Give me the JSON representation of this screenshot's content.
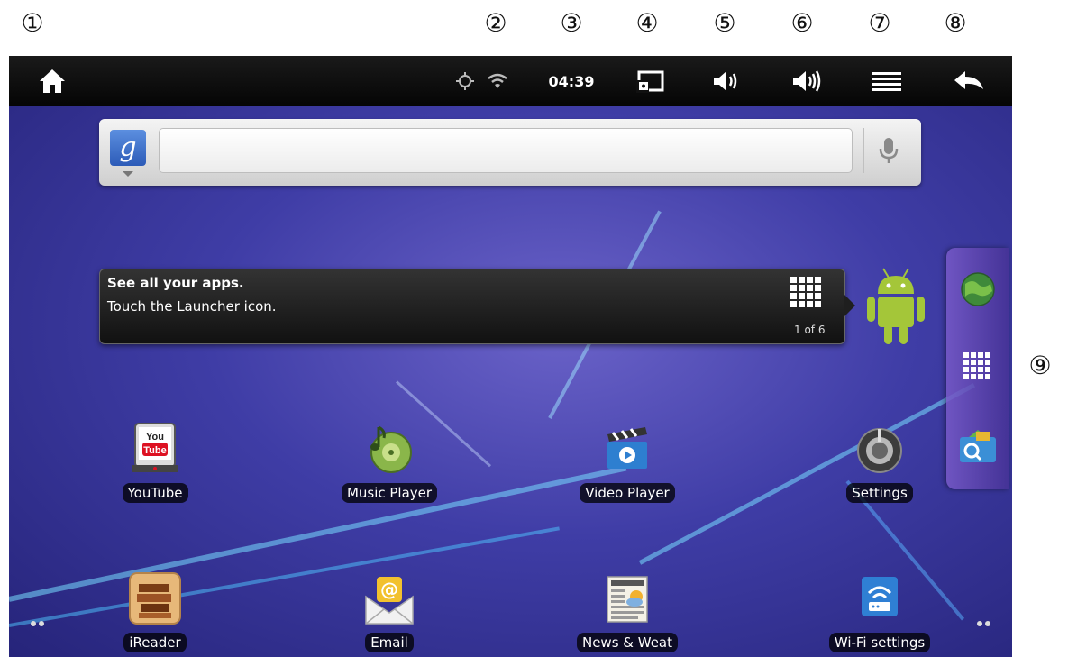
{
  "callouts": [
    "①",
    "②",
    "③",
    "④",
    "⑤",
    "⑥",
    "⑦",
    "⑧",
    "⑨"
  ],
  "status_bar": {
    "time": "04:39",
    "icons": [
      "home-icon",
      "gps-icon",
      "wifi-icon",
      "screenshot-icon",
      "volume-down-icon",
      "volume-up-icon",
      "menu-icon",
      "back-icon"
    ]
  },
  "search": {
    "placeholder": "",
    "logo": "g"
  },
  "tip": {
    "title": "See all your apps.",
    "body": "Touch the Launcher icon.",
    "page": "1 of 6"
  },
  "apps": {
    "row1": [
      {
        "label": "YouTube",
        "icon": "youtube-icon"
      },
      {
        "label": "Music Player",
        "icon": "music-player-icon"
      },
      {
        "label": "Video Player",
        "icon": "video-player-icon"
      },
      {
        "label": "Settings",
        "icon": "settings-icon"
      }
    ],
    "row2": [
      {
        "label": "iReader",
        "icon": "ireader-icon"
      },
      {
        "label": "Email",
        "icon": "email-icon"
      },
      {
        "label": "News & Weat",
        "icon": "news-weather-icon"
      },
      {
        "label": "Wi-Fi settings",
        "icon": "wifi-settings-icon"
      }
    ]
  },
  "dock": [
    "browser-icon",
    "launcher-icon",
    "search-app-icon"
  ],
  "colors": {
    "statusbar": "#0a0a0a",
    "wallpaper": "#3f3da6",
    "accent": "#5ec8ff"
  }
}
